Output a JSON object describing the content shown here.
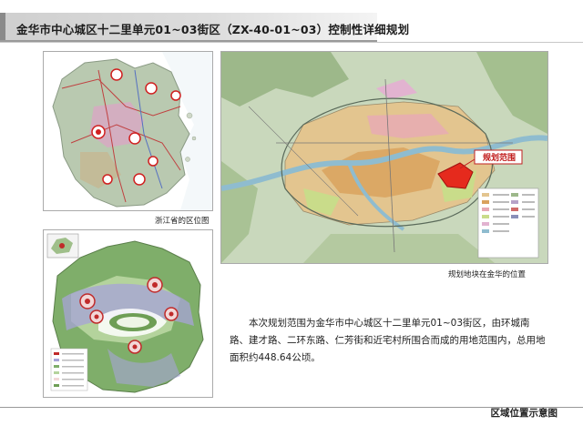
{
  "header": {
    "title": "金华市中心城区十二里单元01~03街区（ZX-40-01~03）控制性详细规划"
  },
  "maps": {
    "province": {
      "caption": "浙江省的区位图"
    },
    "city": {
      "caption": "规划地块在金华的位置",
      "callout": "规划范围"
    },
    "region": {}
  },
  "description": {
    "text": "本次规划范围为金华市中心城区十二里单元01~03街区，由环城南路、建才路、二环东路、仁芳街和近宅村所围合而成的用地范围内，总用地面积约448.64公顷。"
  },
  "footer": {
    "caption": "区域位置示意图"
  },
  "colors": {
    "highlight": "#e52a1d",
    "river": "#9fc8d8",
    "urban": "#e3c58f",
    "green": "#6ea050"
  }
}
